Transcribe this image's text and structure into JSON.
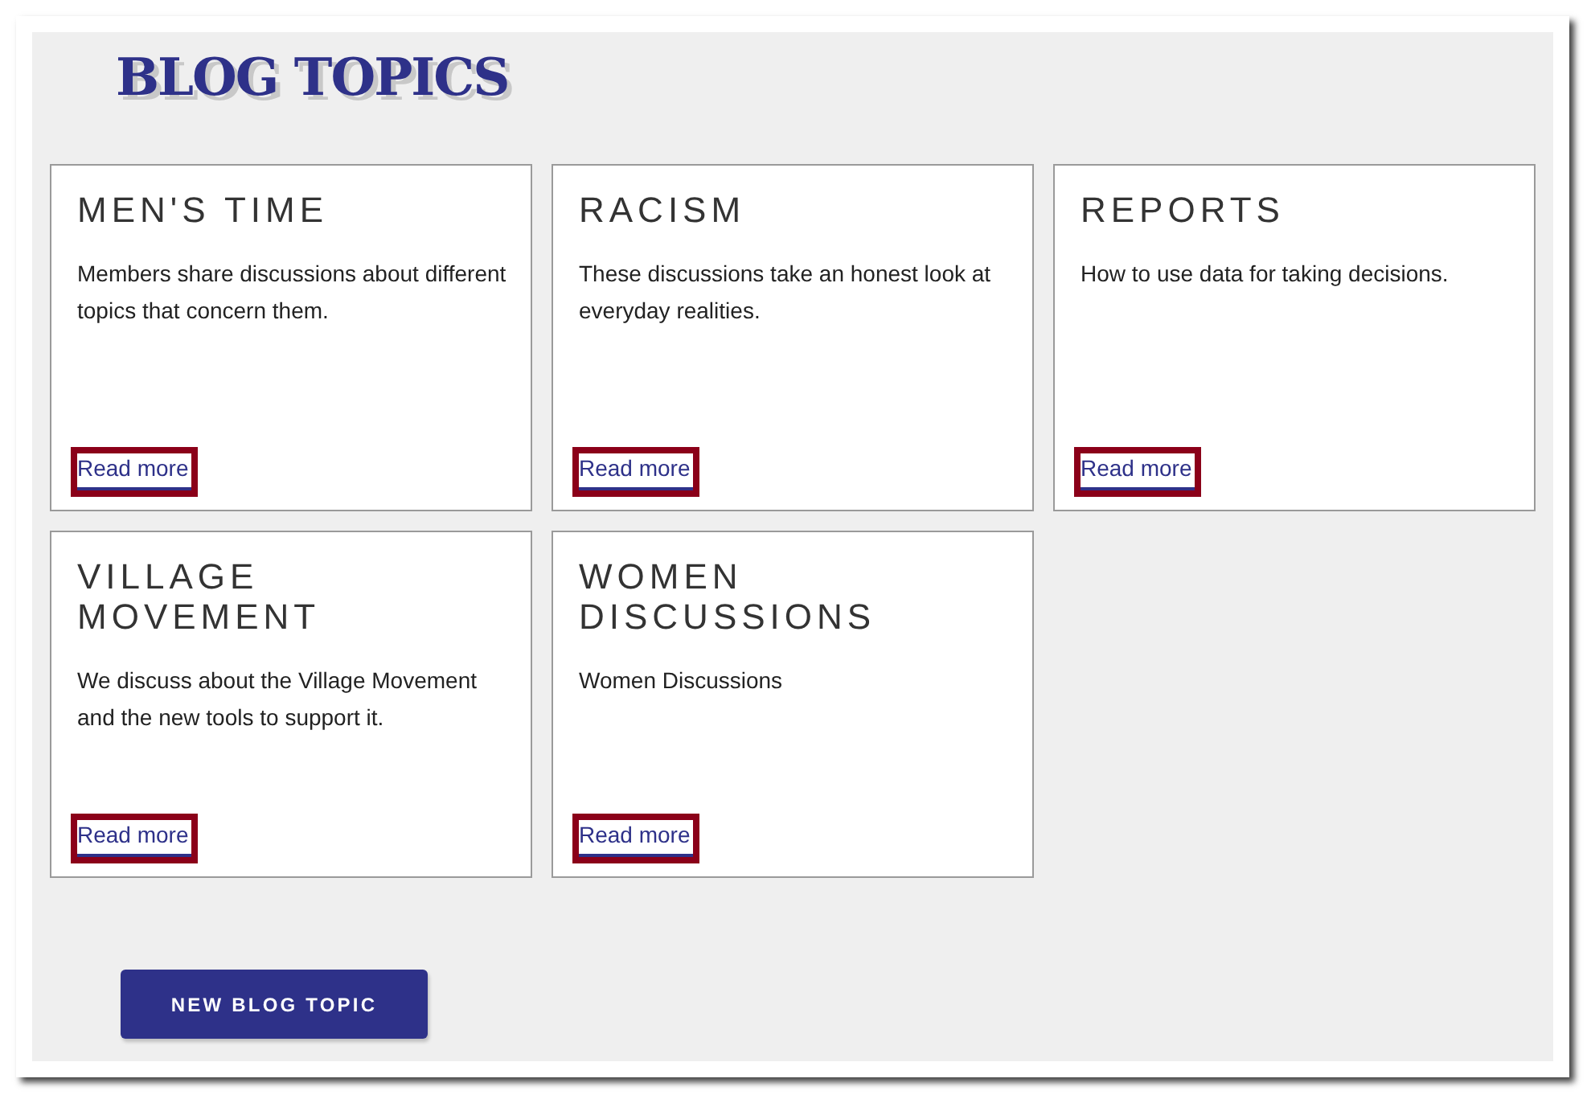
{
  "page": {
    "title": "BLOG TOPICS"
  },
  "topics": [
    {
      "title": "MEN'S TIME",
      "description": "Members share discussions about different topics that concern them.",
      "link": "Read more"
    },
    {
      "title": "RACISM",
      "description": "These discussions take an honest look at everyday realities.",
      "link": "Read more"
    },
    {
      "title": "REPORTS",
      "description": "How to use data for taking decisions.",
      "link": "Read more"
    },
    {
      "title": "VILLAGE MOVEMENT",
      "description": "We discuss about the Village Movement and the new tools to support it.",
      "link": "Read more"
    },
    {
      "title": "WOMEN DISCUSSIONS",
      "description": "Women Discussions",
      "link": "Read more"
    }
  ],
  "new_topic_button": "NEW BLOG TOPIC"
}
